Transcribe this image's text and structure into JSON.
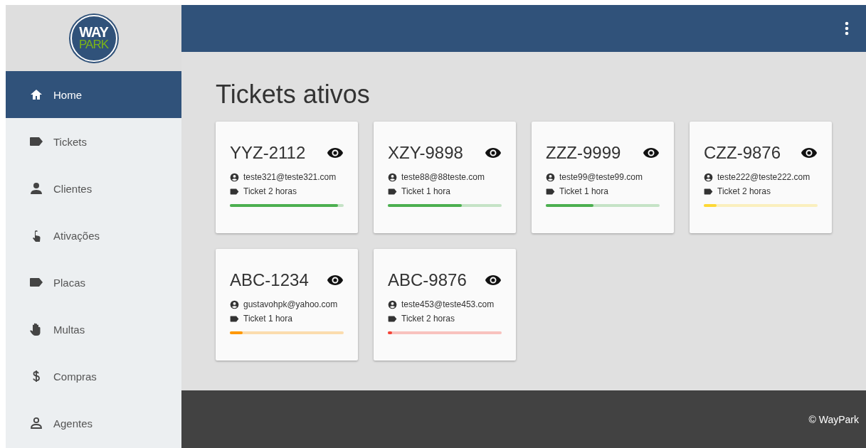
{
  "logo": {
    "line_1": "WAY",
    "line_2": "PARK"
  },
  "sidebar": {
    "items": [
      {
        "label": "Home",
        "kind": "home",
        "selected": true
      },
      {
        "label": "Tickets",
        "kind": "tag",
        "selected": false
      },
      {
        "label": "Clientes",
        "kind": "person",
        "selected": false
      },
      {
        "label": "Ativações",
        "kind": "touch",
        "selected": false
      },
      {
        "label": "Placas",
        "kind": "tag",
        "selected": false
      },
      {
        "label": "Multas",
        "kind": "hand",
        "selected": false
      },
      {
        "label": "Compras",
        "kind": "dollar",
        "selected": false
      },
      {
        "label": "Agentes",
        "kind": "outline",
        "selected": false
      }
    ]
  },
  "page_title": "Tickets ativos",
  "tickets": [
    {
      "plate": "YYZ-2112",
      "email": "teste321@teste321.com",
      "ticket": "Ticket 2 horas",
      "level": 0.95,
      "color": "#4caf50"
    },
    {
      "plate": "XZY-9898",
      "email": "teste88@88teste.com",
      "ticket": "Ticket 1 hora",
      "level": 0.65,
      "color": "#4caf50"
    },
    {
      "plate": "ZZZ-9999",
      "email": "teste99@teste99.com",
      "ticket": "Ticket 1 hora",
      "level": 0.42,
      "color": "#4caf50"
    },
    {
      "plate": "CZZ-9876",
      "email": "teste222@teste222.com",
      "ticket": "Ticket 2 horas",
      "level": 0.11,
      "color": "#fdd835"
    },
    {
      "plate": "ABC-1234",
      "email": "gustavohpk@yahoo.com",
      "ticket": "Ticket 1 hora",
      "level": 0.11,
      "color": "#ff9800"
    },
    {
      "plate": "ABC-9876",
      "email": "teste453@teste453.com",
      "ticket": "Ticket 2 horas",
      "level": 0.04,
      "color": "#f44336"
    }
  ],
  "footer": "© WayPark"
}
